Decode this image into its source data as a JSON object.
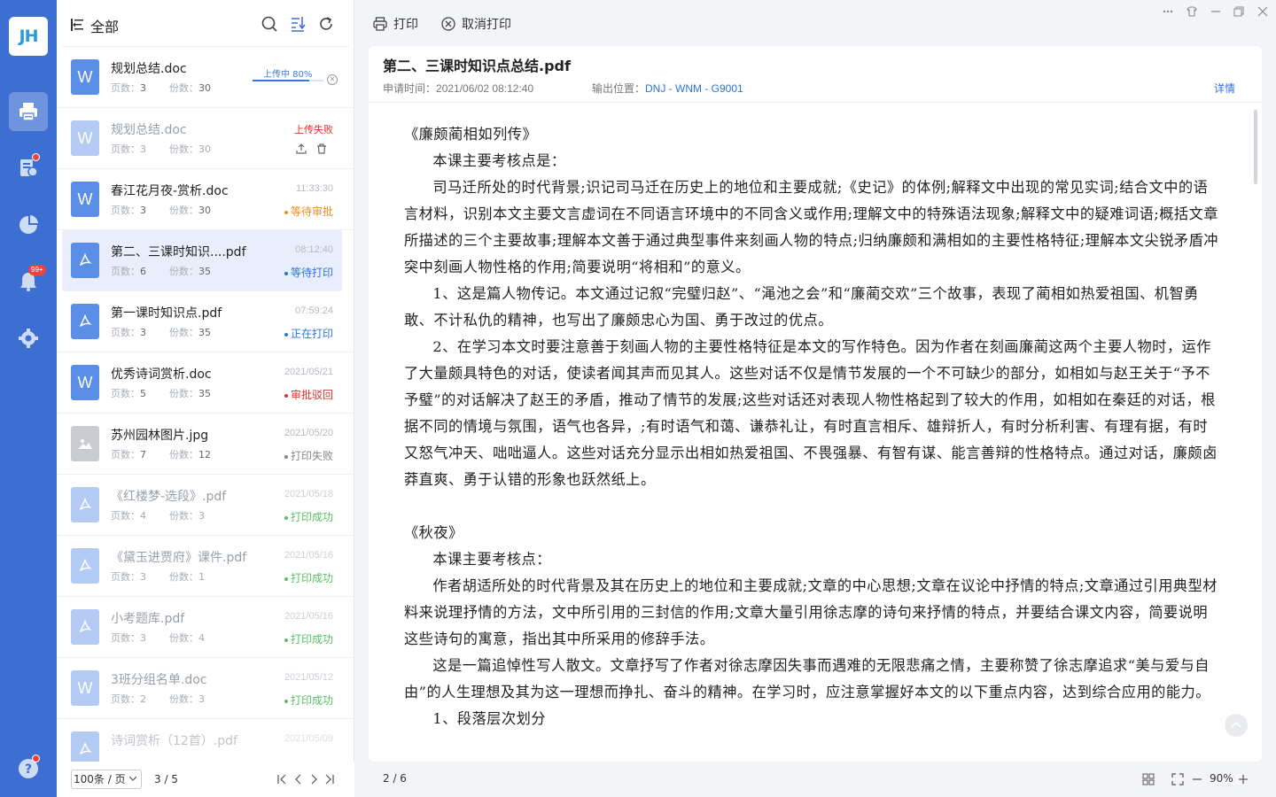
{
  "app": {
    "logo_text": "JH"
  },
  "rail": {
    "items": [
      {
        "icon": "printer-icon",
        "active": true
      },
      {
        "icon": "approval-icon",
        "dot": true
      },
      {
        "icon": "pie-chart-icon"
      },
      {
        "icon": "bell-icon",
        "badge": "99+"
      },
      {
        "icon": "gear-icon"
      }
    ],
    "help": {
      "icon": "help-icon",
      "dot": true
    }
  },
  "list": {
    "title": "全部",
    "items": [
      {
        "name": "规划总结.doc",
        "type": "W",
        "pages_label": "页数：",
        "pages": "3",
        "copies_label": "份数：",
        "copies": "30",
        "upload_label": "上传中  80%",
        "upload_progress": 0.8
      },
      {
        "name": "规划总结.doc",
        "type": "W",
        "pages_label": "页数：",
        "pages": "3",
        "copies_label": "份数：",
        "copies": "30",
        "fail_label": "上传失败"
      },
      {
        "name": "春江花月夜-赏析.doc",
        "type": "W",
        "pages_label": "页数：",
        "pages": "3",
        "copies_label": "份数：",
        "copies": "30",
        "date": "11:33:30",
        "status": "等待审批",
        "status_color": "orange"
      },
      {
        "name": "第二、三课时知识....pdf",
        "type": "pdf",
        "pages_label": "页数：",
        "pages": "6",
        "copies_label": "份数：",
        "copies": "35",
        "date": "08:12:40",
        "status": "等待打印",
        "status_color": "blue",
        "selected": true
      },
      {
        "name": "第一课时知识点.pdf",
        "type": "pdf",
        "pages_label": "页数：",
        "pages": "3",
        "copies_label": "份数：",
        "copies": "35",
        "date": "07:59:24",
        "status": "正在打印",
        "status_color": "blue"
      },
      {
        "name": "优秀诗词赏析.doc",
        "type": "W",
        "pages_label": "页数：",
        "pages": "5",
        "copies_label": "份数：",
        "copies": "35",
        "date": "2021/05/21",
        "status": "审批驳回",
        "status_color": "red"
      },
      {
        "name": "苏州园林图片.jpg",
        "type": "img",
        "pages_label": "页数：",
        "pages": "7",
        "copies_label": "份数：",
        "copies": "12",
        "date": "2021/05/20",
        "status": "打印失败",
        "status_color": "gray"
      },
      {
        "name": "《红楼梦-选段》.pdf",
        "type": "pdf",
        "pages_label": "页数：",
        "pages": "4",
        "copies_label": "份数：",
        "copies": "3",
        "date": "2021/05/18",
        "status": "打印成功",
        "status_color": "green",
        "faded": true
      },
      {
        "name": "《黛玉进贾府》课件.pdf",
        "type": "pdf",
        "pages_label": "页数：",
        "pages": "3",
        "copies_label": "份数：",
        "copies": "1",
        "date": "2021/05/16",
        "status": "打印成功",
        "status_color": "green",
        "faded": true
      },
      {
        "name": "小考题库.pdf",
        "type": "pdf",
        "pages_label": "页数：",
        "pages": "3",
        "copies_label": "份数：",
        "copies": "4",
        "date": "2021/05/16",
        "status": "打印成功",
        "status_color": "green",
        "faded": true
      },
      {
        "name": "3班分组名单.doc",
        "type": "W",
        "pages_label": "页数：",
        "pages": "2",
        "copies_label": "份数：",
        "copies": "3",
        "date": "2021/05/12",
        "status": "打印成功",
        "status_color": "green",
        "faded": true
      },
      {
        "name": "诗词赏析（12首）.pdf",
        "type": "pdf",
        "pages_label": "页数：",
        "pages": "",
        "copies_label": "",
        "copies": "",
        "date": "2021/05/09",
        "status": "",
        "status_color": "green",
        "faded": true
      }
    ],
    "footer": {
      "page_size": "100条 / 页",
      "page_indicator": "3 / 5"
    }
  },
  "toolbar": {
    "print_label": "打印",
    "cancel_label": "取消打印"
  },
  "document": {
    "title": "第二、三课时知识点总结.pdf",
    "request_time_label": "申请时间：",
    "request_time": "2021/06/02   08:12:40",
    "output_label": "输出位置：",
    "output_location": "DNJ - WNM - G9001",
    "detail_label": "详情",
    "paragraphs": [
      "《廉颇蔺相如列传》",
      "本课主要考核点是：",
      "司马迁所处的时代背景;识记司马迁在历史上的地位和主要成就;《史记》的体例;解释文中出现的常见实词;结合文中的语言材料，识别本文主要文言虚词在不同语言环境中的不同含义或作用;理解文中的特殊语法现象;解释文中的疑难词语;概括文章所描述的三个主要故事;理解本文善于通过典型事件来刻画人物的特点;归纳廉颇和满相如的主要性格特征;理解本文尖锐矛盾冲突中刻画人物性格的作用;简要说明“将相和”的意义。",
      "1、这是篇人物传记。本文通过记叙“完璧归赵”、“渑池之会”和“廉蔺交欢”三个故事，表现了蔺相如热爱祖国、机智勇敢、不计私仇的精神，也写出了廉颇忠心为国、勇于改过的优点。",
      "2、在学习本文时要注意善于刻画人物的主要性格特征是本文的写作特色。因为作者在刻画廉蔺这两个主要人物时，运作了大量颇具特色的对话，使读者闻其声而见其人。这些对话不仅是情节发展的一个不可缺少的部分，如相如与赵王关于“予不予璧”的对话解决了赵王的矛盾，推动了情节的发展;这些对话还对表现人物性格起到了较大的作用，如相如在秦廷的对话，根据不同的情境与氛围，语气也各异，;有时语气和蔼、谦恭礼让，有时直言相斥、雄辩折人，有时分析利害、有理有据，有时又怒气冲天、咄咄逼人。这些对话充分显示出相如热爱祖国、不畏强暴、有智有谋、能言善辩的性格特点。通过对话，廉颇卤莽直爽、勇于认错的形象也跃然纸上。",
      "《秋夜》",
      "本课主要考核点：",
      "作者胡适所处的时代背景及其在历史上的地位和主要成就;文章的中心思想;文章在议论中抒情的特点;文章通过引用典型材料来说理抒情的方法，文中所引用的三封信的作用;文章大量引用徐志摩的诗句来抒情的特点，并要结合课文内容，简要说明这些诗句的寓意，指出其中所采用的修辞手法。",
      "这是一篇追悼性写人散文。文章抒写了作者对徐志摩因失事而遇难的无限悲痛之情，主要称赞了徐志摩追求“美与爱与自由”的人生理想及其为这一理想而挣扎、奋斗的精神。在学习时，应注意掌握好本文的以下重点内容，达到综合应用的能力。",
      "1、段落层次划分"
    ]
  },
  "statusbar": {
    "page": "2 / 6",
    "zoom": "90%"
  }
}
